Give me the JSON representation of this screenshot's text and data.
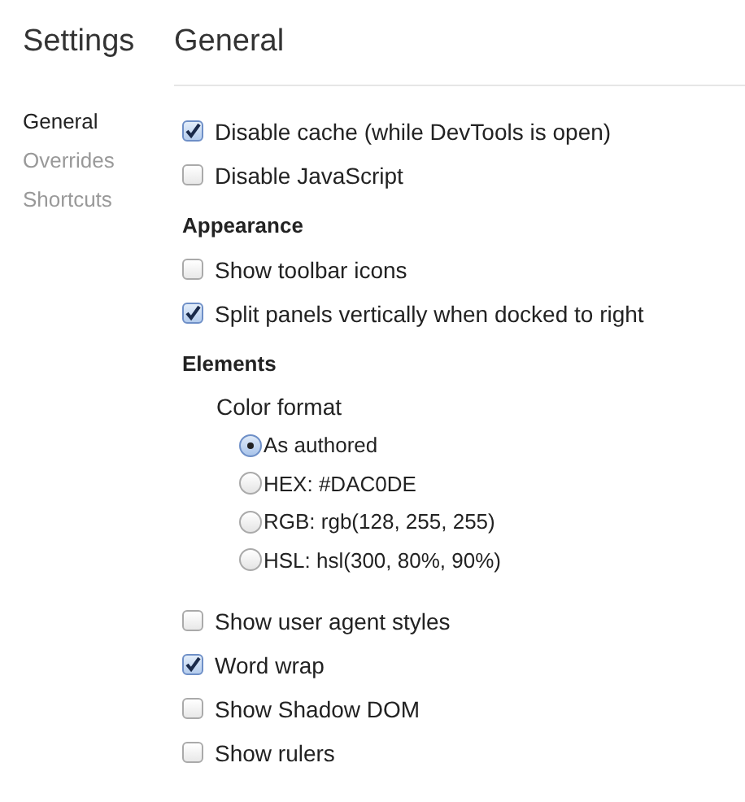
{
  "sidebar": {
    "title": "Settings",
    "items": [
      {
        "label": "General",
        "selected": true
      },
      {
        "label": "Overrides",
        "selected": false
      },
      {
        "label": "Shortcuts",
        "selected": false
      }
    ]
  },
  "panel": {
    "title": "General",
    "sections": [
      {
        "items": [
          {
            "kind": "checkbox",
            "label": "Disable cache (while DevTools is open)",
            "checked": true
          },
          {
            "kind": "checkbox",
            "label": "Disable JavaScript",
            "checked": false
          }
        ]
      },
      {
        "heading": "Appearance",
        "items": [
          {
            "kind": "checkbox",
            "label": "Show toolbar icons",
            "checked": false
          },
          {
            "kind": "checkbox",
            "label": "Split panels vertically when docked to right",
            "checked": true
          }
        ]
      },
      {
        "heading": "Elements",
        "items": [
          {
            "kind": "radio-group",
            "label": "Color format",
            "options": [
              {
                "label": "As authored",
                "selected": true
              },
              {
                "label": "HEX: #DAC0DE",
                "selected": false
              },
              {
                "label": "RGB: rgb(128, 255, 255)",
                "selected": false
              },
              {
                "label": "HSL: hsl(300, 80%, 90%)",
                "selected": false
              }
            ]
          },
          {
            "kind": "checkbox",
            "label": "Show user agent styles",
            "checked": false
          },
          {
            "kind": "checkbox",
            "label": "Word wrap",
            "checked": true
          },
          {
            "kind": "checkbox",
            "label": "Show Shadow DOM",
            "checked": false
          },
          {
            "kind": "checkbox",
            "label": "Show rulers",
            "checked": false
          }
        ]
      }
    ]
  }
}
